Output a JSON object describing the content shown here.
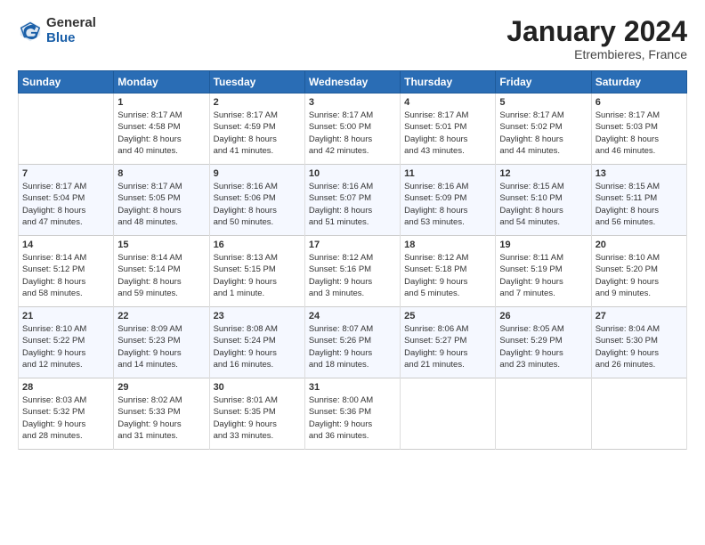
{
  "header": {
    "logo_general": "General",
    "logo_blue": "Blue",
    "month_title": "January 2024",
    "location": "Etrembieres, France"
  },
  "days_of_week": [
    "Sunday",
    "Monday",
    "Tuesday",
    "Wednesday",
    "Thursday",
    "Friday",
    "Saturday"
  ],
  "weeks": [
    [
      {
        "day": "",
        "lines": []
      },
      {
        "day": "1",
        "lines": [
          "Sunrise: 8:17 AM",
          "Sunset: 4:58 PM",
          "Daylight: 8 hours",
          "and 40 minutes."
        ]
      },
      {
        "day": "2",
        "lines": [
          "Sunrise: 8:17 AM",
          "Sunset: 4:59 PM",
          "Daylight: 8 hours",
          "and 41 minutes."
        ]
      },
      {
        "day": "3",
        "lines": [
          "Sunrise: 8:17 AM",
          "Sunset: 5:00 PM",
          "Daylight: 8 hours",
          "and 42 minutes."
        ]
      },
      {
        "day": "4",
        "lines": [
          "Sunrise: 8:17 AM",
          "Sunset: 5:01 PM",
          "Daylight: 8 hours",
          "and 43 minutes."
        ]
      },
      {
        "day": "5",
        "lines": [
          "Sunrise: 8:17 AM",
          "Sunset: 5:02 PM",
          "Daylight: 8 hours",
          "and 44 minutes."
        ]
      },
      {
        "day": "6",
        "lines": [
          "Sunrise: 8:17 AM",
          "Sunset: 5:03 PM",
          "Daylight: 8 hours",
          "and 46 minutes."
        ]
      }
    ],
    [
      {
        "day": "7",
        "lines": [
          "Sunrise: 8:17 AM",
          "Sunset: 5:04 PM",
          "Daylight: 8 hours",
          "and 47 minutes."
        ]
      },
      {
        "day": "8",
        "lines": [
          "Sunrise: 8:17 AM",
          "Sunset: 5:05 PM",
          "Daylight: 8 hours",
          "and 48 minutes."
        ]
      },
      {
        "day": "9",
        "lines": [
          "Sunrise: 8:16 AM",
          "Sunset: 5:06 PM",
          "Daylight: 8 hours",
          "and 50 minutes."
        ]
      },
      {
        "day": "10",
        "lines": [
          "Sunrise: 8:16 AM",
          "Sunset: 5:07 PM",
          "Daylight: 8 hours",
          "and 51 minutes."
        ]
      },
      {
        "day": "11",
        "lines": [
          "Sunrise: 8:16 AM",
          "Sunset: 5:09 PM",
          "Daylight: 8 hours",
          "and 53 minutes."
        ]
      },
      {
        "day": "12",
        "lines": [
          "Sunrise: 8:15 AM",
          "Sunset: 5:10 PM",
          "Daylight: 8 hours",
          "and 54 minutes."
        ]
      },
      {
        "day": "13",
        "lines": [
          "Sunrise: 8:15 AM",
          "Sunset: 5:11 PM",
          "Daylight: 8 hours",
          "and 56 minutes."
        ]
      }
    ],
    [
      {
        "day": "14",
        "lines": [
          "Sunrise: 8:14 AM",
          "Sunset: 5:12 PM",
          "Daylight: 8 hours",
          "and 58 minutes."
        ]
      },
      {
        "day": "15",
        "lines": [
          "Sunrise: 8:14 AM",
          "Sunset: 5:14 PM",
          "Daylight: 8 hours",
          "and 59 minutes."
        ]
      },
      {
        "day": "16",
        "lines": [
          "Sunrise: 8:13 AM",
          "Sunset: 5:15 PM",
          "Daylight: 9 hours",
          "and 1 minute."
        ]
      },
      {
        "day": "17",
        "lines": [
          "Sunrise: 8:12 AM",
          "Sunset: 5:16 PM",
          "Daylight: 9 hours",
          "and 3 minutes."
        ]
      },
      {
        "day": "18",
        "lines": [
          "Sunrise: 8:12 AM",
          "Sunset: 5:18 PM",
          "Daylight: 9 hours",
          "and 5 minutes."
        ]
      },
      {
        "day": "19",
        "lines": [
          "Sunrise: 8:11 AM",
          "Sunset: 5:19 PM",
          "Daylight: 9 hours",
          "and 7 minutes."
        ]
      },
      {
        "day": "20",
        "lines": [
          "Sunrise: 8:10 AM",
          "Sunset: 5:20 PM",
          "Daylight: 9 hours",
          "and 9 minutes."
        ]
      }
    ],
    [
      {
        "day": "21",
        "lines": [
          "Sunrise: 8:10 AM",
          "Sunset: 5:22 PM",
          "Daylight: 9 hours",
          "and 12 minutes."
        ]
      },
      {
        "day": "22",
        "lines": [
          "Sunrise: 8:09 AM",
          "Sunset: 5:23 PM",
          "Daylight: 9 hours",
          "and 14 minutes."
        ]
      },
      {
        "day": "23",
        "lines": [
          "Sunrise: 8:08 AM",
          "Sunset: 5:24 PM",
          "Daylight: 9 hours",
          "and 16 minutes."
        ]
      },
      {
        "day": "24",
        "lines": [
          "Sunrise: 8:07 AM",
          "Sunset: 5:26 PM",
          "Daylight: 9 hours",
          "and 18 minutes."
        ]
      },
      {
        "day": "25",
        "lines": [
          "Sunrise: 8:06 AM",
          "Sunset: 5:27 PM",
          "Daylight: 9 hours",
          "and 21 minutes."
        ]
      },
      {
        "day": "26",
        "lines": [
          "Sunrise: 8:05 AM",
          "Sunset: 5:29 PM",
          "Daylight: 9 hours",
          "and 23 minutes."
        ]
      },
      {
        "day": "27",
        "lines": [
          "Sunrise: 8:04 AM",
          "Sunset: 5:30 PM",
          "Daylight: 9 hours",
          "and 26 minutes."
        ]
      }
    ],
    [
      {
        "day": "28",
        "lines": [
          "Sunrise: 8:03 AM",
          "Sunset: 5:32 PM",
          "Daylight: 9 hours",
          "and 28 minutes."
        ]
      },
      {
        "day": "29",
        "lines": [
          "Sunrise: 8:02 AM",
          "Sunset: 5:33 PM",
          "Daylight: 9 hours",
          "and 31 minutes."
        ]
      },
      {
        "day": "30",
        "lines": [
          "Sunrise: 8:01 AM",
          "Sunset: 5:35 PM",
          "Daylight: 9 hours",
          "and 33 minutes."
        ]
      },
      {
        "day": "31",
        "lines": [
          "Sunrise: 8:00 AM",
          "Sunset: 5:36 PM",
          "Daylight: 9 hours",
          "and 36 minutes."
        ]
      },
      {
        "day": "",
        "lines": []
      },
      {
        "day": "",
        "lines": []
      },
      {
        "day": "",
        "lines": []
      }
    ]
  ]
}
